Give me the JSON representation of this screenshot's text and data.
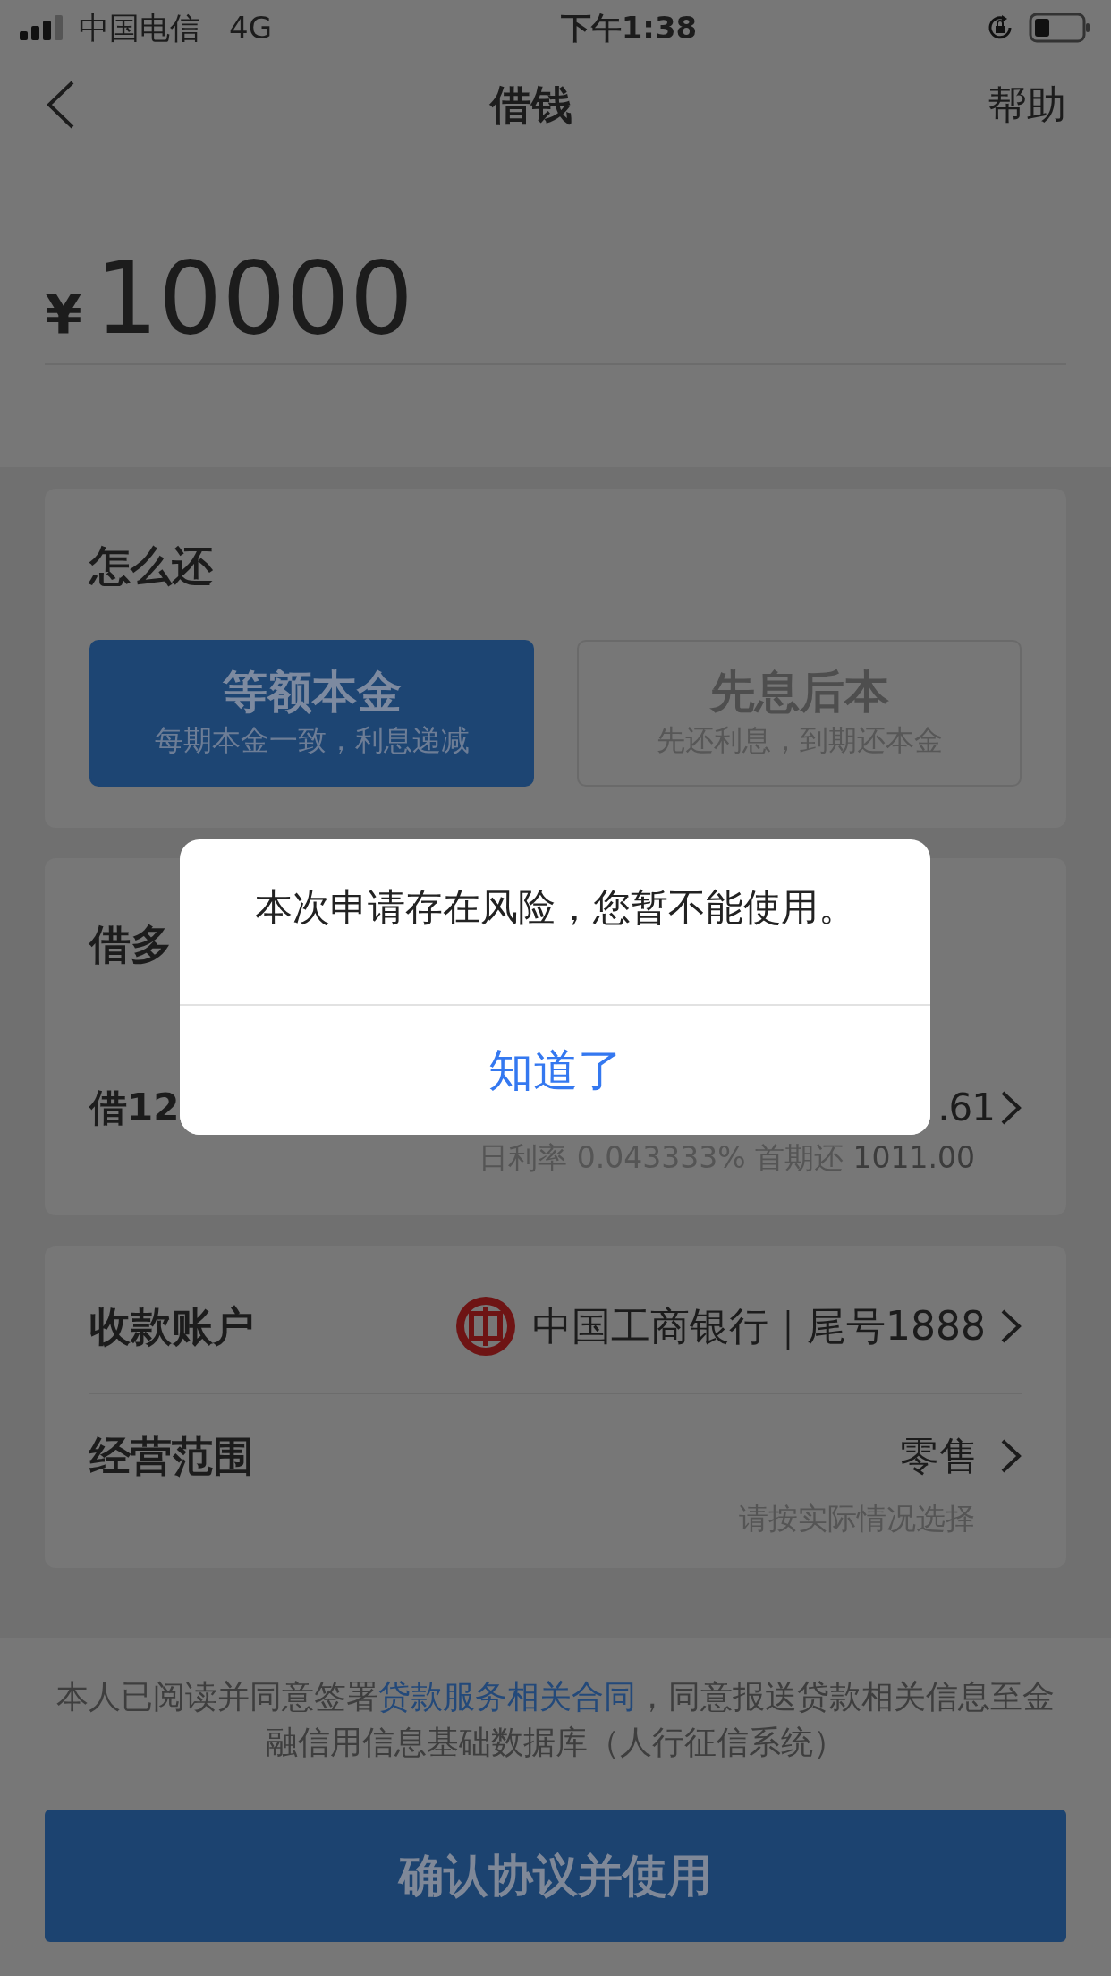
{
  "status_bar": {
    "carrier": "中国电信",
    "network": "4G",
    "time": "下午1:38"
  },
  "nav": {
    "title": "借钱",
    "action": "帮助"
  },
  "amount": {
    "currency": "¥",
    "value": "10000"
  },
  "repayment": {
    "title": "怎么还",
    "options": [
      {
        "label": "等额本金",
        "desc": "每期本金一致，利息递减",
        "selected": true
      },
      {
        "label": "先息后本",
        "desc": "先还利息，到期还本金",
        "selected": false
      }
    ]
  },
  "loan": {
    "title": "借多",
    "term": "借12",
    "interest": ".61",
    "details": "日利率 0.043333%  首期还 **1011.00**"
  },
  "account": {
    "label": "收款账户",
    "bank": "中国工商银行｜尾号1888"
  },
  "scope": {
    "label": "经营范围",
    "value": "零售",
    "hint": "请按实际情况选择"
  },
  "consent": {
    "before": "本人已阅读并同意签署",
    "link": "贷款服务相关合同",
    "after": "，同意报送贷款相关信息至金融信用信息基础数据库（人行征信系统）"
  },
  "confirm_button": "确认协议并使用",
  "dialog": {
    "message": "本次申请存在风险，您暂不能使用。",
    "button": "知道了"
  }
}
